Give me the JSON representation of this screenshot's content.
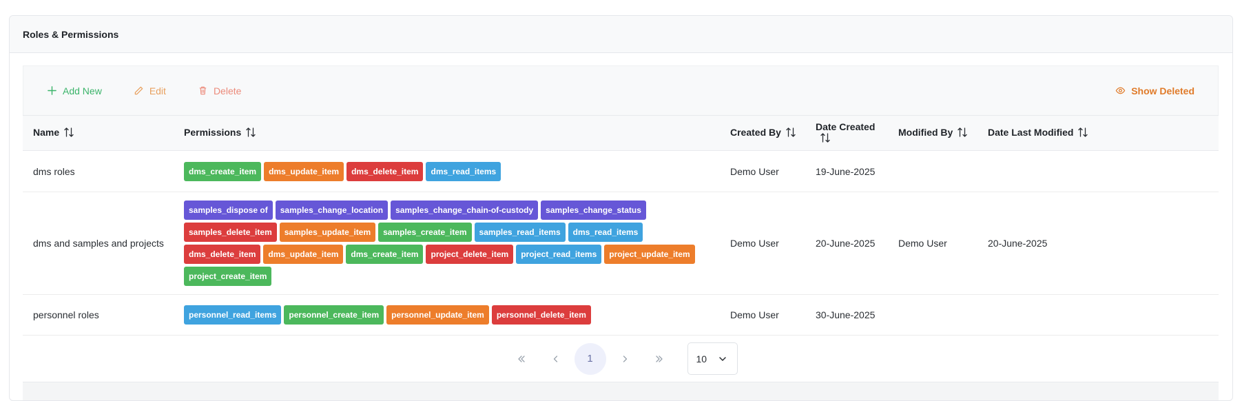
{
  "panel": {
    "title": "Roles & Permissions"
  },
  "toolbar": {
    "add_label": "Add New",
    "edit_label": "Edit",
    "delete_label": "Delete",
    "show_deleted_label": "Show Deleted"
  },
  "columns": {
    "name": "Name",
    "permissions": "Permissions",
    "created_by": "Created By",
    "date_created": "Date Created",
    "modified_by": "Modified By",
    "date_last_modified": "Date Last Modified"
  },
  "rows": [
    {
      "name": "dms roles",
      "permissions": [
        {
          "label": "dms_create_item",
          "color": "#4cb85c"
        },
        {
          "label": "dms_update_item",
          "color": "#ed7d2b"
        },
        {
          "label": "dms_delete_item",
          "color": "#dc3d3d"
        },
        {
          "label": "dms_read_items",
          "color": "#3fa3df"
        }
      ],
      "created_by": "Demo User",
      "date_created": "19-June-2025",
      "modified_by": "",
      "date_last_modified": ""
    },
    {
      "name": "dms and samples and projects",
      "permissions": [
        {
          "label": "samples_dispose of",
          "color": "#6657d7"
        },
        {
          "label": "samples_change_location",
          "color": "#6657d7"
        },
        {
          "label": "samples_change_chain-of-custody",
          "color": "#6657d7"
        },
        {
          "label": "samples_change_status",
          "color": "#6657d7"
        },
        {
          "label": "samples_delete_item",
          "color": "#dc3d3d"
        },
        {
          "label": "samples_update_item",
          "color": "#ed7d2b"
        },
        {
          "label": "samples_create_item",
          "color": "#4cb85c"
        },
        {
          "label": "samples_read_items",
          "color": "#3fa3df"
        },
        {
          "label": "dms_read_items",
          "color": "#3fa3df"
        },
        {
          "label": "dms_delete_item",
          "color": "#dc3d3d"
        },
        {
          "label": "dms_update_item",
          "color": "#ed7d2b"
        },
        {
          "label": "dms_create_item",
          "color": "#4cb85c"
        },
        {
          "label": "project_delete_item",
          "color": "#dc3d3d"
        },
        {
          "label": "project_read_items",
          "color": "#3fa3df"
        },
        {
          "label": "project_update_item",
          "color": "#ed7d2b"
        },
        {
          "label": "project_create_item",
          "color": "#4cb85c"
        }
      ],
      "created_by": "Demo User",
      "date_created": "20-June-2025",
      "modified_by": "Demo User",
      "date_last_modified": "20-June-2025"
    },
    {
      "name": "personnel roles",
      "permissions": [
        {
          "label": "personnel_read_items",
          "color": "#3fa3df"
        },
        {
          "label": "personnel_create_item",
          "color": "#4cb85c"
        },
        {
          "label": "personnel_update_item",
          "color": "#ed7d2b"
        },
        {
          "label": "personnel_delete_item",
          "color": "#dc3d3d"
        }
      ],
      "created_by": "Demo User",
      "date_created": "30-June-2025",
      "modified_by": "",
      "date_last_modified": ""
    }
  ],
  "pagination": {
    "current_page": "1",
    "page_size": "10"
  },
  "icons": {
    "first": "chevrons-left-icon",
    "prev": "chevron-left-icon",
    "next": "chevron-right-icon",
    "last": "chevrons-right-icon",
    "sort": "sort-icon"
  }
}
